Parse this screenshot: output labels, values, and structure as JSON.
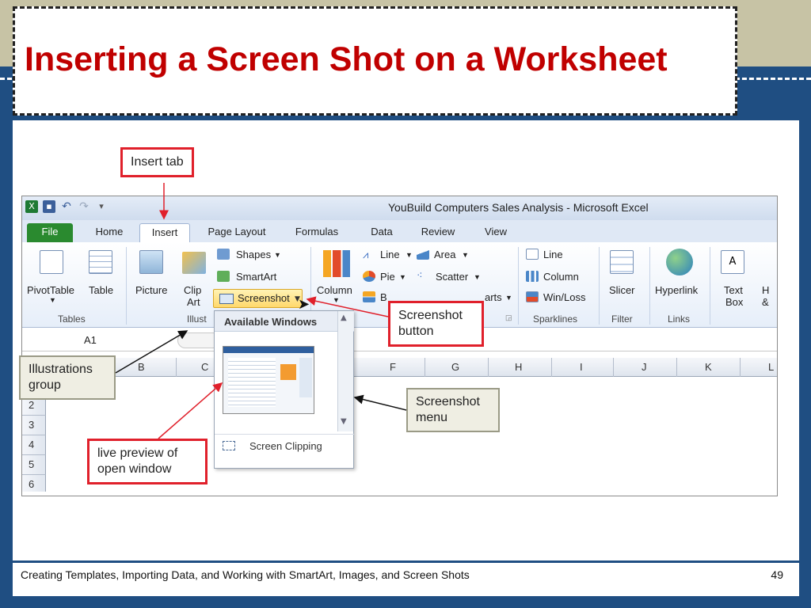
{
  "slide": {
    "title": "Inserting a Screen Shot on a Worksheet",
    "footer": "Creating Templates, Importing Data, and Working with SmartArt, Images, and Screen Shots",
    "page_number": "49"
  },
  "excel": {
    "window_title": "YouBuild Computers Sales Analysis  -  Microsoft Excel",
    "tabs": [
      "File",
      "Home",
      "Insert",
      "Page Layout",
      "Formulas",
      "Data",
      "Review",
      "View"
    ],
    "active_tab": "Insert",
    "ribbon": {
      "pivottable": "PivotTable",
      "table": "Table",
      "picture": "Picture",
      "clip": "Clip",
      "art": "Art",
      "shapes": "Shapes",
      "smartart": "SmartArt",
      "screenshot": "Screenshot",
      "column": "Column",
      "line": "Line",
      "pie": "Pie",
      "bar_partial": "B",
      "area": "Area",
      "scatter": "Scatter",
      "other_charts_partial": "arts",
      "spark_line": "Line",
      "spark_column": "Column",
      "spark_winloss": "Win/Loss",
      "slicer": "Slicer",
      "hyperlink": "Hyperlink",
      "text": "Text",
      "box": "Box",
      "h_partial": "H",
      "amp_partial": "&",
      "groups": {
        "tables": "Tables",
        "illustrations_partial": "Illust",
        "sparklines": "Sparklines",
        "filter": "Filter",
        "links": "Links"
      }
    },
    "name_box": "A1",
    "columns": [
      "B",
      "C",
      "F",
      "G",
      "H",
      "I",
      "J",
      "K",
      "L"
    ],
    "rows": [
      "2",
      "3",
      "4",
      "5",
      "6"
    ],
    "screenshot_menu": {
      "header": "Available Windows",
      "screen_clipping": "Screen Clipping"
    }
  },
  "callouts": {
    "insert_tab": "Insert tab",
    "screenshot_button_l1": "Screenshot",
    "screenshot_button_l2": "button",
    "illustrations_l1": "Illustrations",
    "illustrations_l2": "group",
    "screenshot_menu_l1": "Screenshot",
    "screenshot_menu_l2": "menu",
    "live_preview_l1": "live preview of",
    "live_preview_l2": "open window"
  },
  "colors": {
    "title_red": "#c00000",
    "slide_blue": "#1f4e82",
    "callout_red": "#e0202b",
    "file_tab_green": "#2a8a2f"
  }
}
